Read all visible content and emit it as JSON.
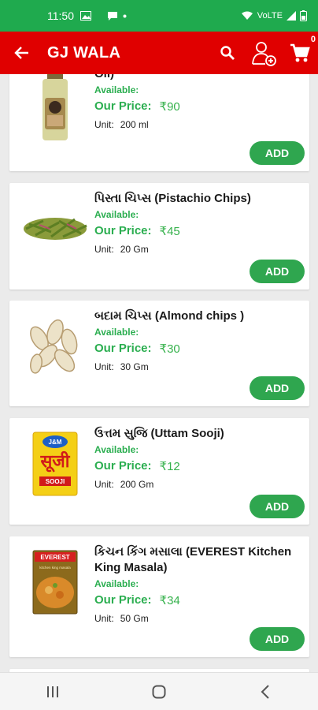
{
  "status": {
    "time": "11:50",
    "network": "VoLTE"
  },
  "app_bar": {
    "title": "GJ WALA",
    "cart_count": "0"
  },
  "labels": {
    "available": "Available:",
    "our_price": "Our Price:",
    "unit": "Unit:",
    "add": "ADD"
  },
  "products": [
    {
      "name": "Oil)",
      "price": "₹90",
      "unit": "200 ml"
    },
    {
      "name": "પિસ્તા ચિપ્સ (Pistachio Chips)",
      "price": "₹45",
      "unit": "20 Gm"
    },
    {
      "name": "બદામ ચિપ્સ (Almond chips )",
      "price": "₹30",
      "unit": "30 Gm"
    },
    {
      "name": "ઉત્તમ સુજિ (Uttam Sooji)",
      "price": "₹12",
      "unit": "200 Gm"
    },
    {
      "name": "કિચન કિંગ મસાલા (EVEREST Kitchen King Masala)",
      "price": "₹34",
      "unit": "50 Gm"
    }
  ],
  "images": {
    "sooji_brand": "J&M",
    "sooji_hindi": "सूजी",
    "sooji_label": "SOOJI",
    "everest_brand": "EVEREST",
    "everest_sub": "kitchen king masala"
  }
}
